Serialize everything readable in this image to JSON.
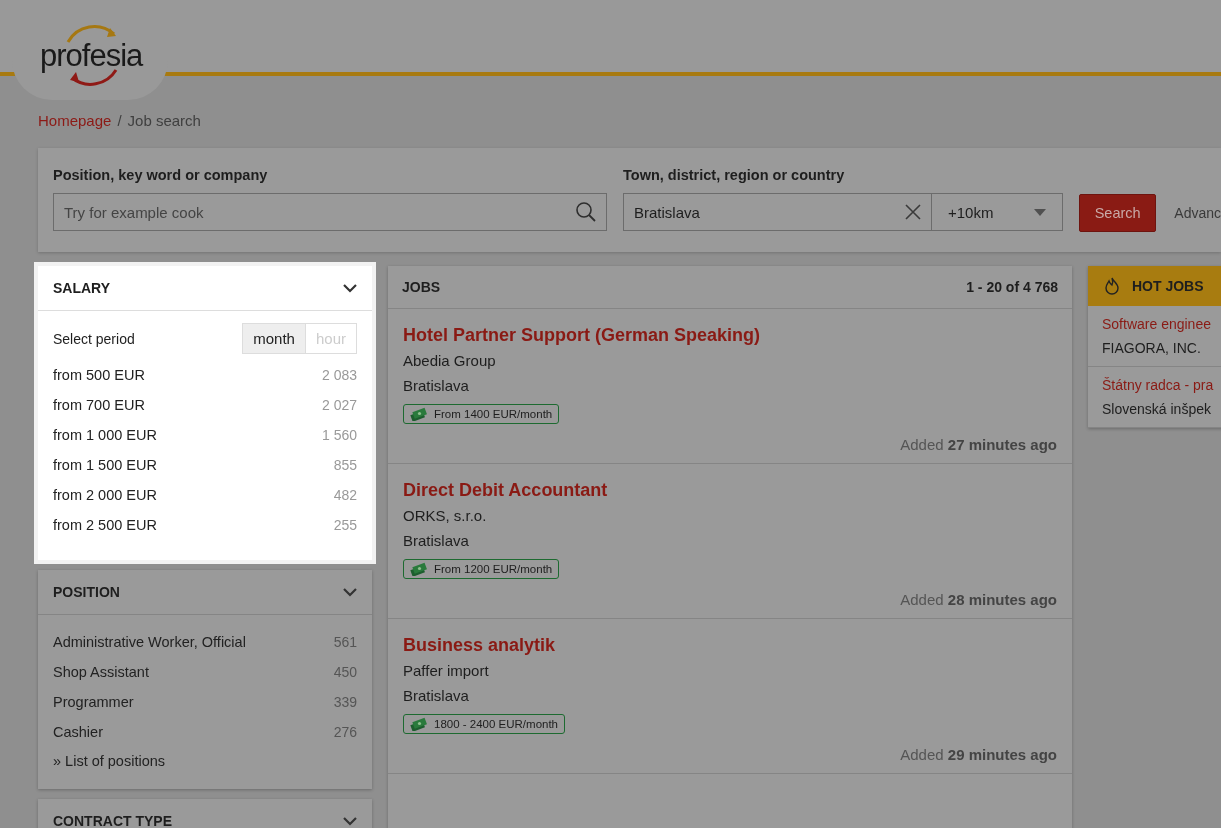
{
  "logo": {
    "text": "profesia"
  },
  "breadcrumb": [
    {
      "label": "Homepage",
      "kind": "link"
    },
    {
      "label": "/",
      "kind": "separator"
    },
    {
      "label": "Job search",
      "kind": "current"
    }
  ],
  "search": {
    "keyword_label": "Position, key word or company",
    "keyword_placeholder": "Try for example cook",
    "location_label": "Town, district, region or country",
    "location_value": "Bratislava",
    "radius": "+10km",
    "button": "Search",
    "advanced": "Advanc"
  },
  "filters": [
    {
      "title": "SALARY",
      "highlighted": true,
      "period_label": "Select period",
      "periods": [
        {
          "label": "month",
          "selected": true
        },
        {
          "label": "hour",
          "selected": false
        }
      ],
      "items": [
        {
          "label": "from 500 EUR",
          "count": "2 083"
        },
        {
          "label": "from 700 EUR",
          "count": "2 027"
        },
        {
          "label": "from 1 000 EUR",
          "count": "1 560"
        },
        {
          "label": "from 1 500 EUR",
          "count": "855"
        },
        {
          "label": "from 2 000 EUR",
          "count": "482"
        },
        {
          "label": "from 2 500 EUR",
          "count": "255"
        }
      ]
    },
    {
      "title": "POSITION",
      "highlighted": false,
      "items": [
        {
          "label": "Administrative Worker, Official",
          "count": "561"
        },
        {
          "label": "Shop Assistant",
          "count": "450"
        },
        {
          "label": "Programmer",
          "count": "339"
        },
        {
          "label": "Cashier",
          "count": "276"
        }
      ],
      "link": "» List of positions"
    },
    {
      "title": "CONTRACT TYPE",
      "highlighted": false
    }
  ],
  "jobs": {
    "title": "JOBS",
    "count": "1 - 20 of 4 768",
    "items": [
      {
        "title": "Hotel Partner Support (German Speaking)",
        "company": "Abedia Group",
        "location": "Bratislava",
        "salary": "From 1400 EUR/month",
        "added": "Added **27 minutes ago**"
      },
      {
        "title": "Direct Debit Accountant",
        "company": "ORKS, s.r.o.",
        "location": "Bratislava",
        "salary": "From 1200 EUR/month",
        "added": "Added **28 minutes ago**"
      },
      {
        "title": "Business analytik",
        "company": "Paffer import",
        "location": "Bratislava",
        "salary": "1800 - 2400 EUR/month",
        "added": "Added **29 minutes ago**"
      }
    ]
  },
  "hot_jobs": {
    "title": "HOT JOBS",
    "items": [
      {
        "title": "Software enginee",
        "company": "FIAGORA, INC."
      },
      {
        "title": "Štátny radca - pra",
        "company": "Slovenská inšpek"
      }
    ]
  }
}
